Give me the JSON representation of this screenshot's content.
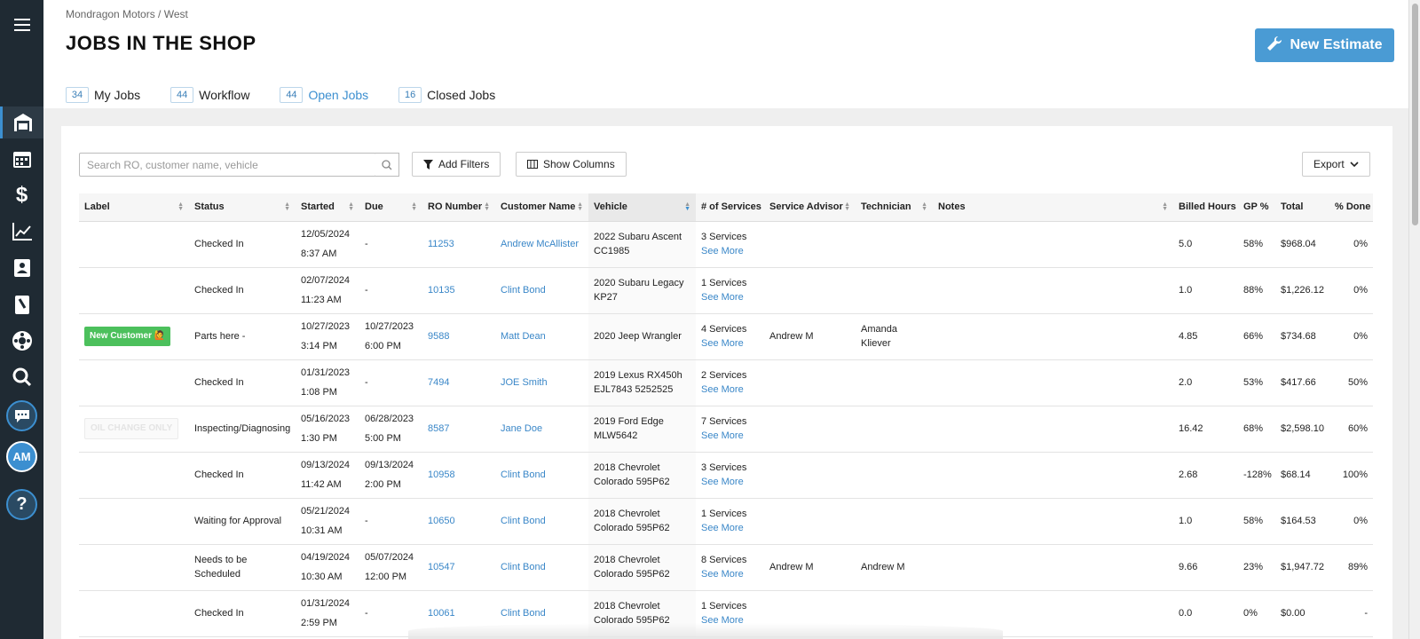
{
  "breadcrumb": "Mondragon Motors / West",
  "title": "JOBS IN THE SHOP",
  "new_estimate_label": "New Estimate",
  "tabs": [
    {
      "count": "34",
      "label": "My Jobs"
    },
    {
      "count": "44",
      "label": "Workflow"
    },
    {
      "count": "44",
      "label": "Open Jobs"
    },
    {
      "count": "16",
      "label": "Closed Jobs"
    }
  ],
  "toolbar": {
    "search_placeholder": "Search RO, customer name, vehicle",
    "add_filters": "Add Filters",
    "show_columns": "Show Columns",
    "export": "Export"
  },
  "rail": {
    "avatar_initials": "AM"
  },
  "columns": [
    "Label",
    "Status",
    "Started",
    "Due",
    "RO Number",
    "Customer Name",
    "Vehicle",
    "# of Services",
    "Service Advisor",
    "Technician",
    "Notes",
    "Billed Hours",
    "GP %",
    "Total",
    "% Done"
  ],
  "rows": [
    {
      "label": "",
      "status": "Checked In",
      "started_date": "12/05/2024",
      "started_time": "8:37 AM",
      "due_date": "-",
      "due_time": "",
      "ro": "11253",
      "customer": "Andrew McAllister",
      "vehicle1": "2022 Subaru Ascent",
      "vehicle2": "CC1985",
      "services": "3 Services",
      "see_more": "See More",
      "advisor": "",
      "technician": "",
      "notes": "",
      "hours": "5.0",
      "gp": "58%",
      "total": "$968.04",
      "done": "0%"
    },
    {
      "label": "",
      "status": "Checked In",
      "started_date": "02/07/2024",
      "started_time": "11:23 AM",
      "due_date": "-",
      "due_time": "",
      "ro": "10135",
      "customer": "Clint Bond",
      "vehicle1": "2020 Subaru Legacy",
      "vehicle2": "KP27",
      "services": "1 Services",
      "see_more": "See More",
      "advisor": "",
      "technician": "",
      "notes": "",
      "hours": "1.0",
      "gp": "88%",
      "total": "$1,226.12",
      "done": "0%"
    },
    {
      "label": "New Customer 🙋",
      "label_style": "green",
      "status": "Parts here -",
      "started_date": "10/27/2023",
      "started_time": "3:14 PM",
      "due_date": "10/27/2023",
      "due_time": "6:00 PM",
      "ro": "9588",
      "customer": "Matt Dean",
      "vehicle1": "2020 Jeep Wrangler",
      "vehicle2": "",
      "services": "4 Services",
      "see_more": "See More",
      "advisor": "Andrew M",
      "technician": "Amanda Kliever",
      "notes": "",
      "hours": "4.85",
      "gp": "66%",
      "total": "$734.68",
      "done": "0%"
    },
    {
      "label": "",
      "status": "Checked In",
      "started_date": "01/31/2023",
      "started_time": "1:08 PM",
      "due_date": "-",
      "due_time": "",
      "ro": "7494",
      "customer": "JOE Smith",
      "vehicle1": "2019 Lexus RX450h",
      "vehicle2": "EJL7843 5252525",
      "services": "2 Services",
      "see_more": "See More",
      "advisor": "",
      "technician": "",
      "notes": "",
      "hours": "2.0",
      "gp": "53%",
      "total": "$417.66",
      "done": "50%"
    },
    {
      "label": "OIL CHANGE ONLY",
      "label_style": "ghost",
      "status": "Inspecting/Diagnosing",
      "started_date": "05/16/2023",
      "started_time": "1:30 PM",
      "due_date": "06/28/2023",
      "due_time": "5:00 PM",
      "ro": "8587",
      "customer": "Jane Doe",
      "vehicle1": "2019 Ford Edge",
      "vehicle2": "MLW5642",
      "services": "7 Services",
      "see_more": "See More",
      "advisor": "",
      "technician": "",
      "notes": "",
      "hours": "16.42",
      "gp": "68%",
      "total": "$2,598.10",
      "done": "60%"
    },
    {
      "label": "",
      "status": "Checked In",
      "started_date": "09/13/2024",
      "started_time": "11:42 AM",
      "due_date": "09/13/2024",
      "due_time": "2:00 PM",
      "ro": "10958",
      "customer": "Clint Bond",
      "vehicle1": "2018 Chevrolet",
      "vehicle2": "Colorado 595P62",
      "services": "3 Services",
      "see_more": "See More",
      "advisor": "",
      "technician": "",
      "notes": "",
      "hours": "2.68",
      "gp": "-128%",
      "total": "$68.14",
      "done": "100%"
    },
    {
      "label": "",
      "status": "Waiting for Approval",
      "started_date": "05/21/2024",
      "started_time": "10:31 AM",
      "due_date": "-",
      "due_time": "",
      "ro": "10650",
      "customer": "Clint Bond",
      "vehicle1": "2018 Chevrolet",
      "vehicle2": "Colorado 595P62",
      "services": "1 Services",
      "see_more": "See More",
      "advisor": "",
      "technician": "",
      "notes": "",
      "hours": "1.0",
      "gp": "58%",
      "total": "$164.53",
      "done": "0%"
    },
    {
      "label": "",
      "status": "Needs to be Scheduled",
      "started_date": "04/19/2024",
      "started_time": "10:30 AM",
      "due_date": "05/07/2024",
      "due_time": "12:00 PM",
      "ro": "10547",
      "customer": "Clint Bond",
      "vehicle1": "2018 Chevrolet",
      "vehicle2": "Colorado 595P62",
      "services": "8 Services",
      "see_more": "See More",
      "advisor": "Andrew M",
      "technician": "Andrew M",
      "notes": "",
      "hours": "9.66",
      "gp": "23%",
      "total": "$1,947.72",
      "done": "89%"
    },
    {
      "label": "",
      "status": "Checked In",
      "started_date": "01/31/2024",
      "started_time": "2:59 PM",
      "due_date": "-",
      "due_time": "",
      "ro": "10061",
      "customer": "Clint Bond",
      "vehicle1": "2018 Chevrolet",
      "vehicle2": "Colorado 595P62",
      "services": "1 Services",
      "see_more": "See More",
      "advisor": "",
      "technician": "",
      "notes": "",
      "hours": "0.0",
      "gp": "0%",
      "total": "$0.00",
      "done": "-"
    }
  ]
}
